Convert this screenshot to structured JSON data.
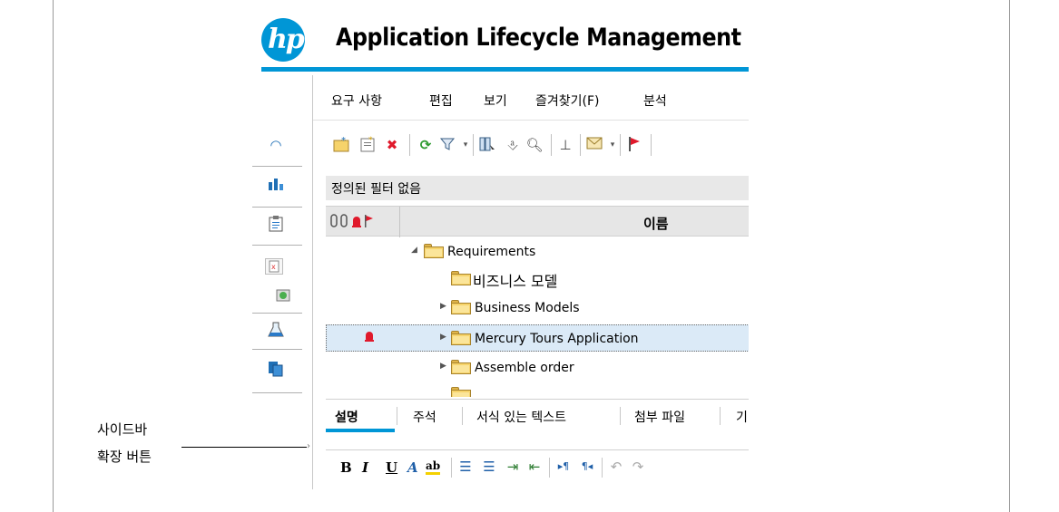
{
  "header": {
    "logo_text": "hp",
    "app_title": "Application Lifecycle Management"
  },
  "colors": {
    "hp_blue": "#0096d6",
    "selection": "#dbeaf7",
    "alert_red": "#e0192b",
    "folder_yellow": "#f6d36b"
  },
  "sidebar": {
    "items": [
      {
        "icon": "dashboard-gauge-icon"
      },
      {
        "icon": "analysis-chart-icon"
      },
      {
        "icon": "requirements-clipboard-icon"
      },
      {
        "icon": "test-plan-icon"
      },
      {
        "icon": "test-resources-icon"
      },
      {
        "icon": "test-lab-flask-icon"
      },
      {
        "icon": "defects-pages-icon"
      }
    ],
    "expand_label": "사이드바\n확장 버튼"
  },
  "menubar": {
    "items": [
      "요구 사항",
      "편집",
      "보기",
      "즐겨찾기(F)",
      "분석"
    ]
  },
  "toolbar": {
    "buttons": [
      "new-folder-icon",
      "new-requirement-icon",
      "delete-icon",
      "refresh-icon",
      "filter-icon",
      "select-columns-icon",
      "attachments-icon",
      "zoom-icon",
      "pin-icon",
      "email-icon",
      "flag-icon"
    ]
  },
  "filter": {
    "text": "정의된 필터 없음"
  },
  "grid": {
    "name_header": "이름"
  },
  "tree": {
    "rows": [
      {
        "label": "Requirements",
        "expanded": true
      },
      {
        "label": "비즈니스 모델"
      },
      {
        "label": "Business Models"
      },
      {
        "label": "Mercury Tours Application",
        "selected": true,
        "alert": true
      },
      {
        "label": "Assemble order"
      }
    ]
  },
  "details_tabs": {
    "items": [
      "설명",
      "주석",
      "서식 있는 텍스트",
      "첨부 파일",
      "기"
    ],
    "active": "설명"
  },
  "format_toolbar": {
    "buttons": [
      "B",
      "I",
      "U",
      "A",
      "ab"
    ]
  },
  "callout": {
    "line1": "사이드바",
    "line2": "확장 버튼"
  }
}
